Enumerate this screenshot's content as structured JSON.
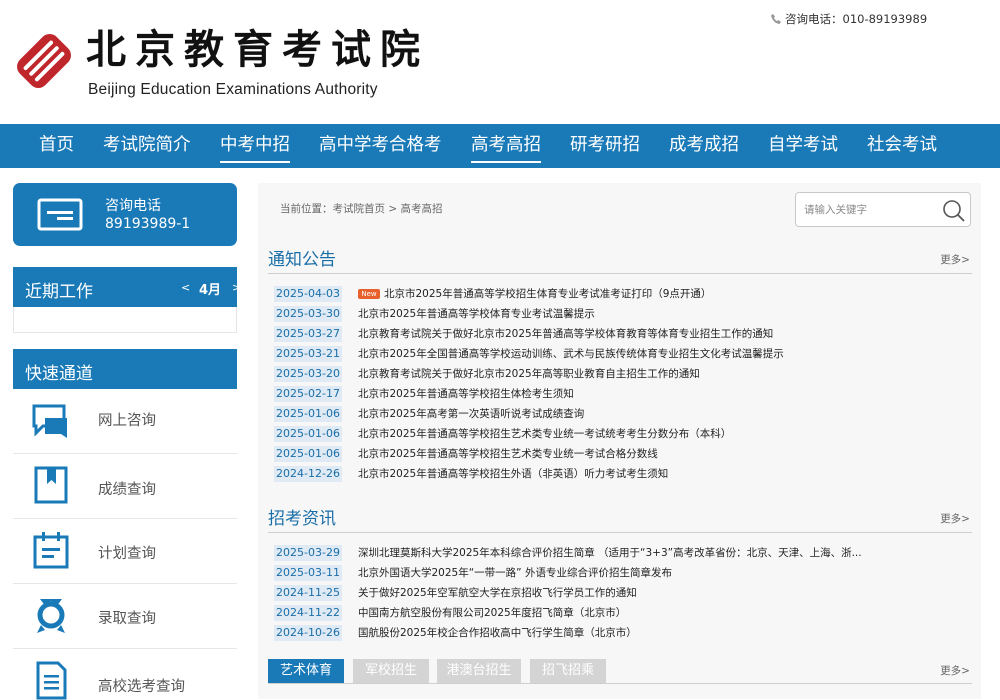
{
  "header": {
    "logo_cn": "北京教育考试院",
    "logo_en": "Beijing Education Examinations Authority",
    "hotline_label": "咨询电话：",
    "hotline_number": "010-89193989"
  },
  "nav": {
    "items": [
      {
        "label": "首页"
      },
      {
        "label": "考试院简介"
      },
      {
        "label": "中考中招"
      },
      {
        "label": "高中学考合格考"
      },
      {
        "label": "高考高招"
      },
      {
        "label": "研考研招"
      },
      {
        "label": "成考成招"
      },
      {
        "label": "自学考试"
      },
      {
        "label": "社会考试"
      }
    ]
  },
  "sidebar": {
    "consult_title": "咨询电话",
    "consult_number": "89193989-1",
    "recent_title": "近期工作",
    "month_prev": "<",
    "month": "4月",
    "month_next": ">",
    "quick_title": "快速通道",
    "quick_items": [
      {
        "label": "网上咨询",
        "icon": "chat-icon"
      },
      {
        "label": "成绩查询",
        "icon": "bookmark-icon"
      },
      {
        "label": "计划查询",
        "icon": "calendar-icon"
      },
      {
        "label": "录取查询",
        "icon": "medal-icon"
      },
      {
        "label": "高校选考查询",
        "icon": "document-icon"
      }
    ]
  },
  "main": {
    "breadcrumb": "当前位置：考试院首页 > 高考高招",
    "search_placeholder": "请输入关键字",
    "notices": {
      "title": "通知公告",
      "more": "更多>",
      "new_badge": "New",
      "items": [
        {
          "date": "2025-04-03",
          "title": "北京市2025年普通高等学校招生体育专业考试准考证打印（9点开通）"
        },
        {
          "date": "2025-03-30",
          "title": "北京市2025年普通高等学校体育专业考试温馨提示"
        },
        {
          "date": "2025-03-27",
          "title": "北京教育考试院关于做好北京市2025年普通高等学校体育教育等体育专业招生工作的通知"
        },
        {
          "date": "2025-03-21",
          "title": "北京市2025年全国普通高等学校运动训练、武术与民族传统体育专业招生文化考试温馨提示"
        },
        {
          "date": "2025-03-20",
          "title": "北京教育考试院关于做好北京市2025年高等职业教育自主招生工作的通知"
        },
        {
          "date": "2025-02-17",
          "title": "北京市2025年普通高等学校招生体检考生须知"
        },
        {
          "date": "2025-01-06",
          "title": "北京市2025年高考第一次英语听说考试成绩查询"
        },
        {
          "date": "2025-01-06",
          "title": "北京市2025年普通高等学校招生艺术类专业统一考试统考考生分数分布（本科）"
        },
        {
          "date": "2025-01-06",
          "title": "北京市2025年普通高等学校招生艺术类专业统一考试合格分数线"
        },
        {
          "date": "2024-12-26",
          "title": "北京市2025年普通高等学校招生外语（非英语）听力考试考生须知"
        }
      ]
    },
    "admissions": {
      "title": "招考资讯",
      "more": "更多>",
      "items": [
        {
          "date": "2025-03-29",
          "title": "深圳北理莫斯科大学2025年本科综合评价招生简章 （适用于“3+3”高考改革省份：北京、天津、上海、浙..."
        },
        {
          "date": "2025-03-11",
          "title": "北京外国语大学2025年“一带一路” 外语专业综合评价招生简章发布"
        },
        {
          "date": "2024-11-25",
          "title": "关于做好2025年空军航空大学在京招收飞行学员工作的通知"
        },
        {
          "date": "2024-11-22",
          "title": "中国南方航空股份有限公司2025年度招飞简章（北京市）"
        },
        {
          "date": "2024-10-26",
          "title": "国航股份2025年校企合作招收高中飞行学生简章（北京市）"
        }
      ]
    },
    "tabs": {
      "items": [
        {
          "label": "艺术体育"
        },
        {
          "label": "军校招生"
        },
        {
          "label": "港澳台招生"
        },
        {
          "label": "招飞招乘"
        }
      ],
      "more": "更多>"
    }
  },
  "colors": {
    "primary_blue": "#1a7ab8",
    "logo_red": "#c0272d",
    "date_bg": "#dfeaf4",
    "new_badge": "#e8612c"
  }
}
